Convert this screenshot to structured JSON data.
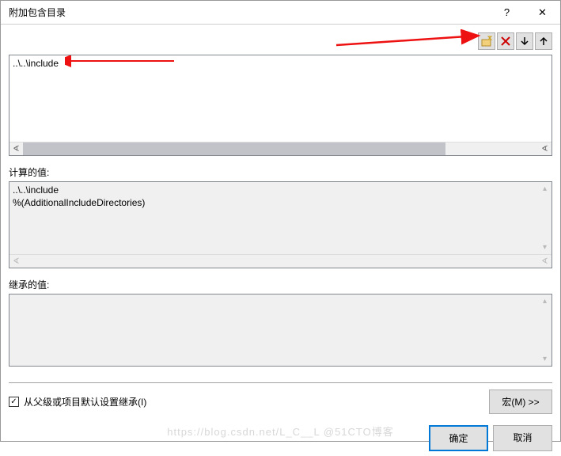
{
  "titlebar": {
    "title": "附加包含目录",
    "help": "?",
    "close": "✕"
  },
  "list": {
    "entries": [
      "..\\..\\include"
    ]
  },
  "computed": {
    "label": "计算的值:",
    "lines": [
      "..\\..\\include",
      "%(AdditionalIncludeDirectories)"
    ]
  },
  "inherited": {
    "label": "继承的值:"
  },
  "checkbox": {
    "label": "从父级或项目默认设置继承(I)",
    "checked": "✓"
  },
  "buttons": {
    "macro": "宏(M) >>",
    "ok": "确定",
    "cancel": "取消"
  },
  "watermark": "https://blog.csdn.net/L_C__L @51CTO博客"
}
